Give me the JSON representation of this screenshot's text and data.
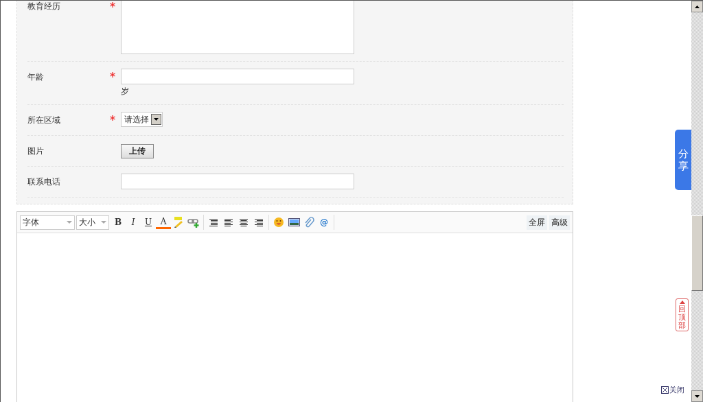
{
  "form": {
    "fields": [
      {
        "label": "教育经历",
        "required": true,
        "kind": "textarea"
      },
      {
        "label": "年龄",
        "required": true,
        "kind": "text",
        "suffix": "岁"
      },
      {
        "label": "所在区域",
        "required": true,
        "kind": "select",
        "value": "请选择"
      },
      {
        "label": "图片",
        "required": false,
        "kind": "upload",
        "button": "上传"
      },
      {
        "label": "联系电话",
        "required": false,
        "kind": "text"
      }
    ]
  },
  "editor": {
    "font_select": "字体",
    "size_select": "大小",
    "tool_groups": [
      [
        {
          "kind": "bold",
          "label": "B"
        },
        {
          "kind": "italic",
          "label": "I"
        },
        {
          "kind": "underline",
          "label": "U"
        },
        {
          "kind": "color",
          "label": "A"
        },
        {
          "kind": "spell"
        },
        {
          "kind": "link"
        }
      ],
      [
        {
          "kind": "align-right-lines"
        },
        {
          "kind": "align-left"
        },
        {
          "kind": "align-center"
        },
        {
          "kind": "align-right"
        }
      ],
      [
        {
          "kind": "emoji"
        },
        {
          "kind": "image"
        },
        {
          "kind": "attach"
        },
        {
          "kind": "mention",
          "label": "@"
        }
      ]
    ],
    "right_buttons": [
      "全屏",
      "高级"
    ]
  },
  "side": {
    "share": "分享",
    "back_to_top": "回顶部",
    "close": "关闭"
  }
}
